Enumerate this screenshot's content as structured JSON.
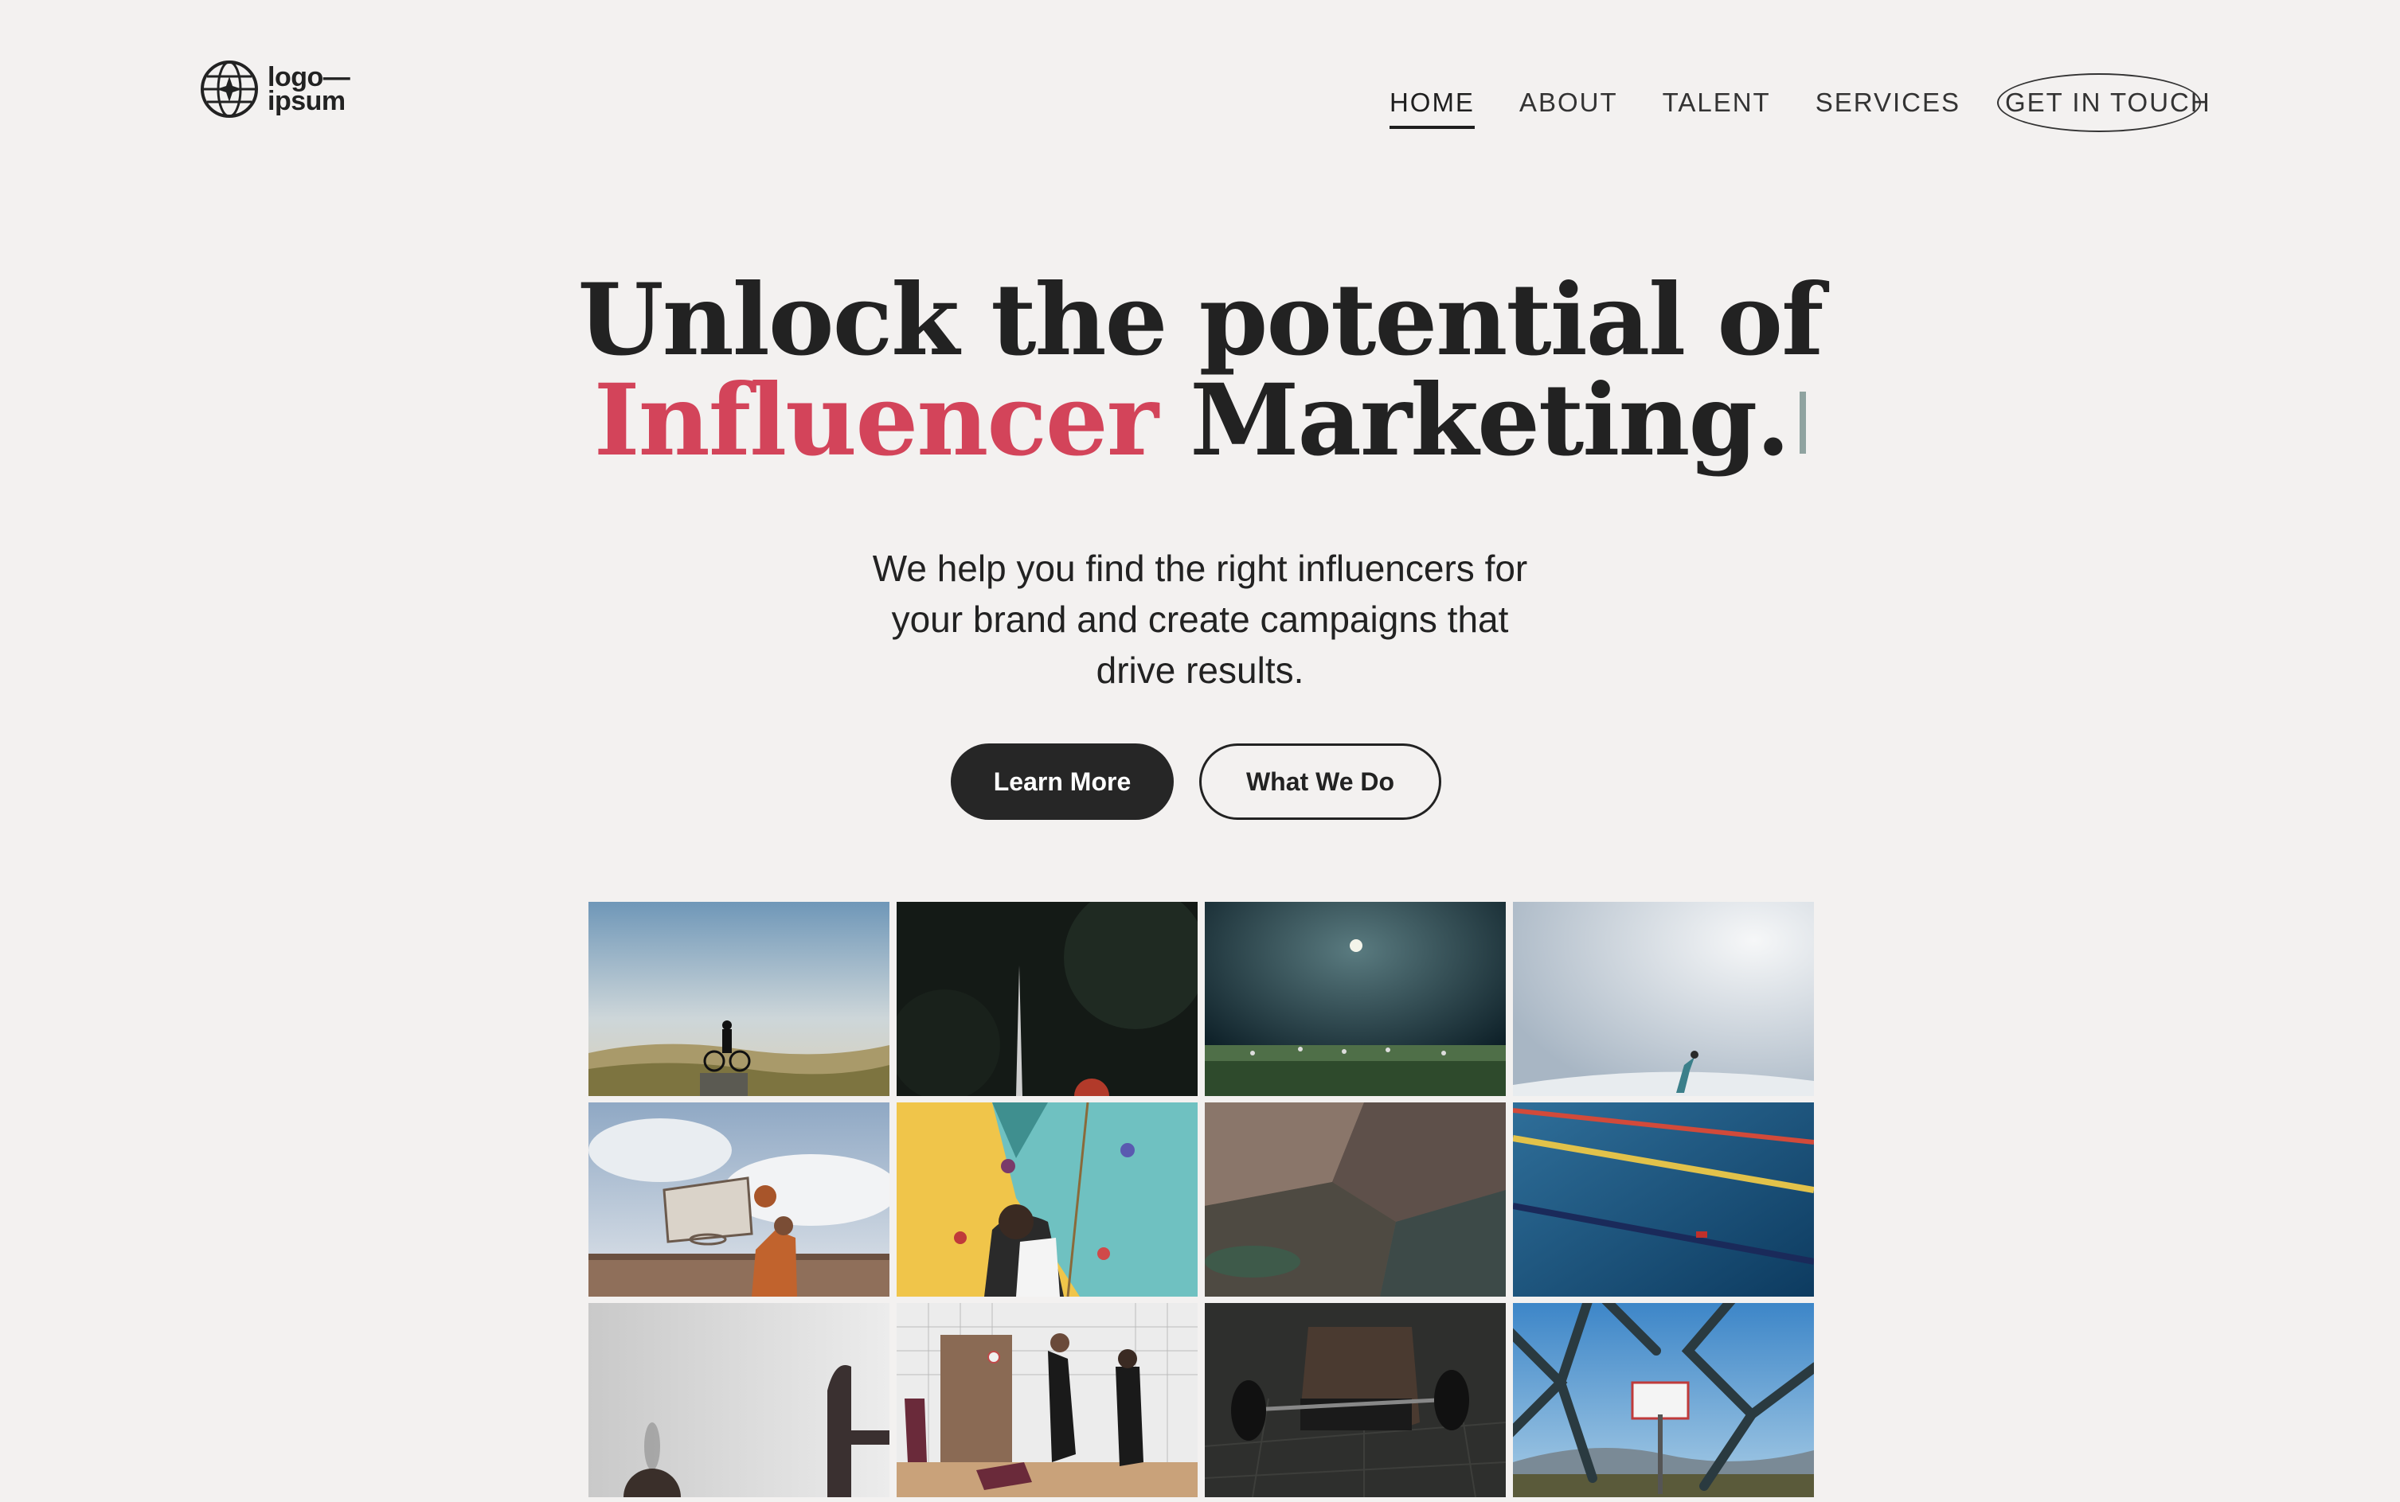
{
  "brand": {
    "logo_line1": "logo—",
    "logo_line2": "ipsum",
    "accent_color": "#d3445a",
    "dark_color": "#262626"
  },
  "nav": {
    "items": [
      {
        "label": "HOME",
        "active": true
      },
      {
        "label": "ABOUT",
        "active": false
      },
      {
        "label": "TALENT",
        "active": false
      },
      {
        "label": "SERVICES",
        "active": false
      }
    ],
    "cta": "GET IN TOUCH"
  },
  "hero": {
    "title_line1": "Unlock the potential of",
    "title_accent": "Influencer",
    "title_rest": "Marketing.",
    "subtitle_line1": "We help you find the right influencers for",
    "subtitle_line2": "your brand and create campaigns that",
    "subtitle_line3": "drive results."
  },
  "buttons": {
    "primary": "Learn More",
    "secondary": "What We Do"
  },
  "gallery": {
    "tiles": [
      "cyclist-on-hilltop-photo",
      "dark-net-pole-photo",
      "night-football-field-photo",
      "skier-in-fog-photo",
      "basketball-hoop-shot-photo",
      "climbing-wall-photo",
      "rock-cliff-photo",
      "swimming-pool-lanes-photo",
      "white-wall-silhouette-photo",
      "volleyball-players-photo",
      "weightlifting-barbell-photo",
      "chainlink-fence-hoop-photo"
    ]
  }
}
